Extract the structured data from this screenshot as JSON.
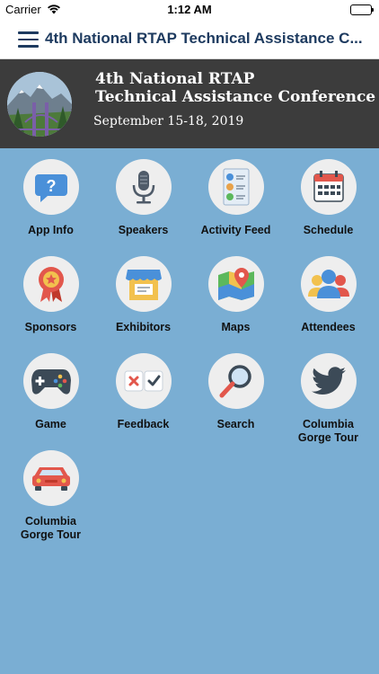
{
  "status_bar": {
    "carrier": "Carrier",
    "time": "1:12 AM"
  },
  "nav": {
    "title": "4th National RTAP Technical Assistance C..."
  },
  "banner": {
    "title_line1": "4th National RTAP",
    "title_line2": "Technical Assistance Conference",
    "date": "September 15-18, 2019"
  },
  "tiles": [
    {
      "label": "App Info",
      "icon": "question-bubble-icon"
    },
    {
      "label": "Speakers",
      "icon": "microphone-icon"
    },
    {
      "label": "Activity Feed",
      "icon": "activity-feed-icon"
    },
    {
      "label": "Schedule",
      "icon": "calendar-icon"
    },
    {
      "label": "Sponsors",
      "icon": "award-ribbon-icon"
    },
    {
      "label": "Exhibitors",
      "icon": "booth-icon"
    },
    {
      "label": "Maps",
      "icon": "map-pin-icon"
    },
    {
      "label": "Attendees",
      "icon": "people-icon"
    },
    {
      "label": "Game",
      "icon": "gamepad-icon"
    },
    {
      "label": "Feedback",
      "icon": "feedback-icon"
    },
    {
      "label": "Search",
      "icon": "magnifier-icon"
    },
    {
      "label": "Columbia Gorge Tour",
      "icon": "twitter-bird-icon"
    },
    {
      "label": "Columbia Gorge Tour",
      "icon": "car-icon"
    }
  ]
}
